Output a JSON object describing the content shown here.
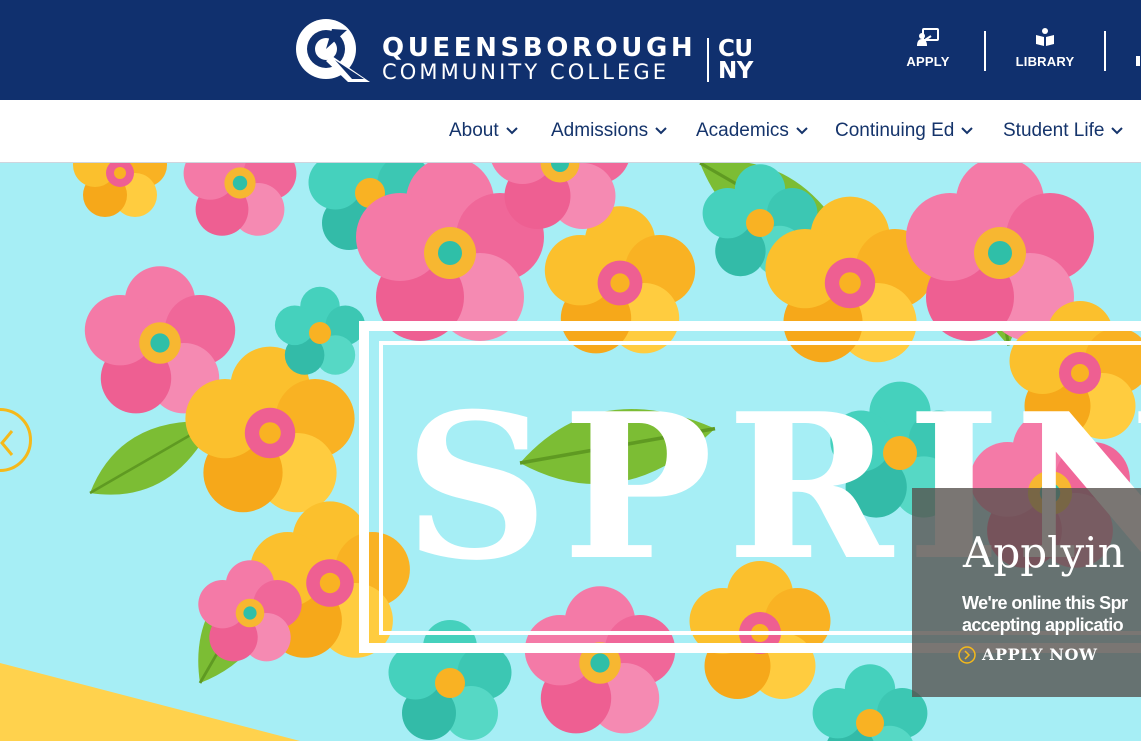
{
  "header": {
    "logo": {
      "line1": "QUEENSBOROUGH",
      "line2": "COMMUNITY COLLEGE",
      "cuny_line1": "CU",
      "cuny_line2": "NY"
    },
    "utility_links": [
      {
        "label": "APPLY",
        "icon": "apply-icon"
      },
      {
        "label": "LIBRARY",
        "icon": "library-icon"
      }
    ]
  },
  "nav": {
    "items": [
      {
        "label": "About"
      },
      {
        "label": "Admissions"
      },
      {
        "label": "Academics"
      },
      {
        "label": "Continuing Ed"
      },
      {
        "label": "Student Life"
      }
    ]
  },
  "hero": {
    "banner_word": "SPRIN",
    "caption": {
      "title": "Applyin",
      "body_line1": "We're online this Spr",
      "body_line2": "accepting applicatio",
      "cta_label": "APPLY NOW"
    }
  },
  "colors": {
    "header_bg": "#10306e",
    "nav_text": "#15346b",
    "accent_yellow": "#f5b91a",
    "hero_sky": "#a6eef5"
  }
}
